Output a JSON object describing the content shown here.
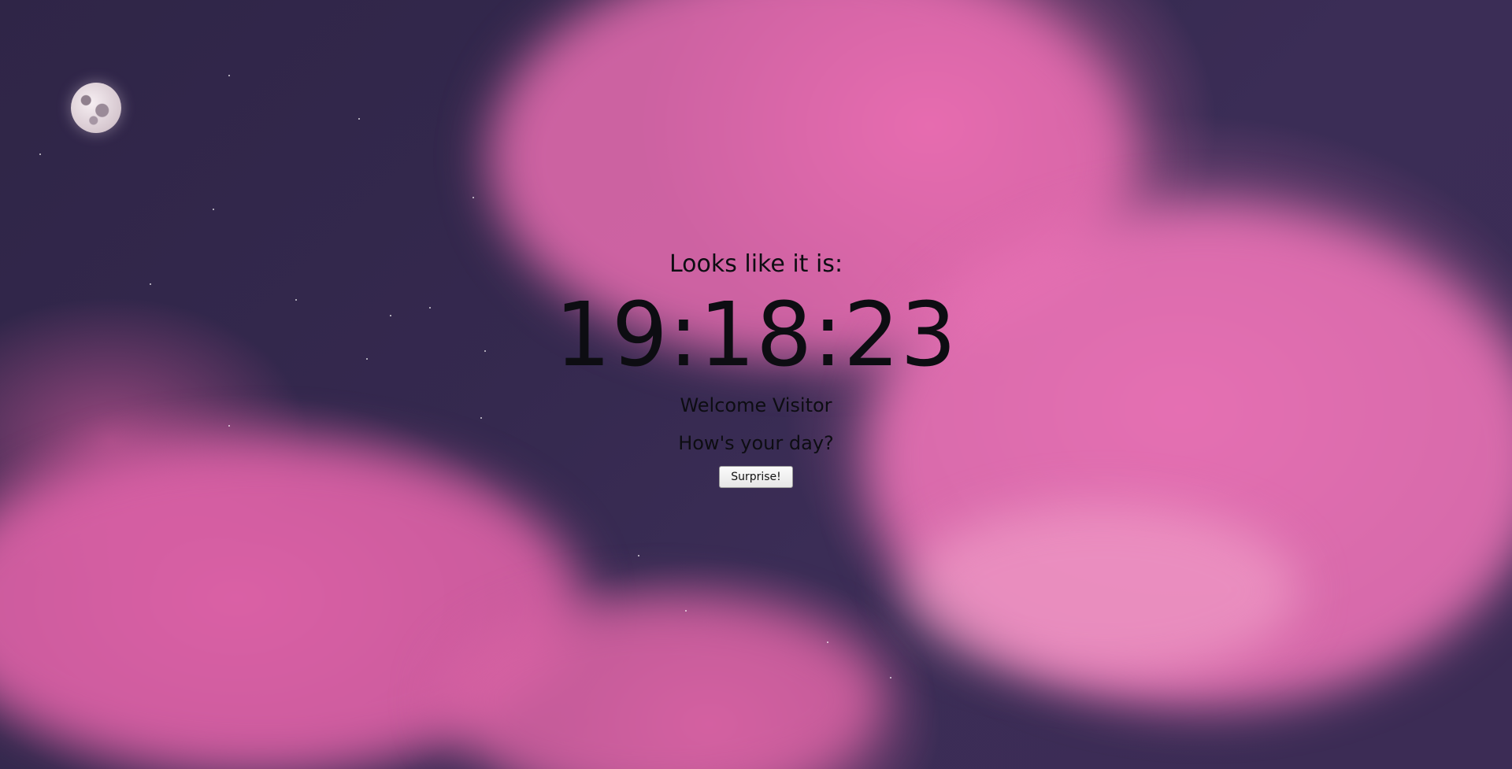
{
  "intro_text": "Looks like it is:",
  "clock": {
    "time": "19:18:23"
  },
  "greeting": "Welcome Visitor",
  "question": "How's your day?",
  "surprise_button": {
    "label": "Surprise!"
  },
  "background": {
    "dark_sky_color": "#35294f",
    "cloud_color": "#e46fb0",
    "moon_icon": "moon-icon"
  }
}
